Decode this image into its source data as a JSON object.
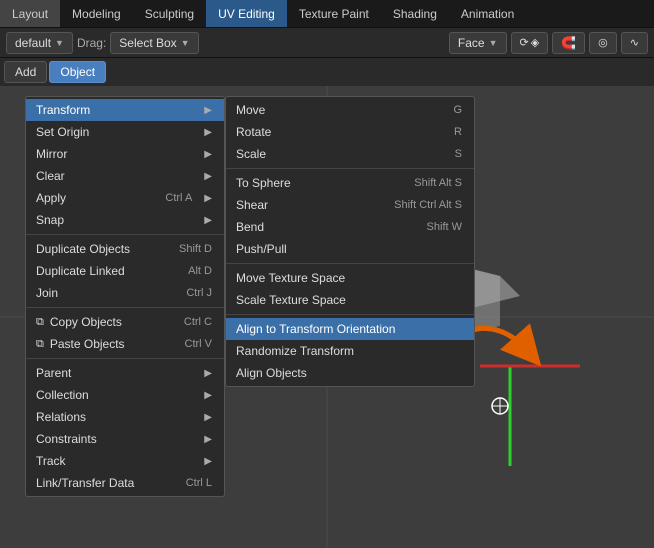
{
  "menubar": {
    "items": [
      {
        "label": "Layout",
        "active": true
      },
      {
        "label": "Modeling",
        "active": false
      },
      {
        "label": "Sculpting",
        "active": false
      },
      {
        "label": "UV Editing",
        "active": false
      },
      {
        "label": "Texture Paint",
        "active": false
      },
      {
        "label": "Shading",
        "active": false
      },
      {
        "label": "Animation",
        "active": false
      }
    ]
  },
  "toolbar": {
    "drag_label": "Drag:",
    "select_mode": "Select Box",
    "mode_dropdown": "Face",
    "default_label": "default"
  },
  "header": {
    "add_label": "Add",
    "object_label": "Object"
  },
  "context_menu": {
    "items": [
      {
        "label": "Transform",
        "submenu": true,
        "highlighted": true
      },
      {
        "label": "Set Origin",
        "submenu": true
      },
      {
        "label": "Mirror",
        "submenu": true
      },
      {
        "label": "Clear",
        "submenu": true
      },
      {
        "label": "Apply",
        "shortcut": "Ctrl A",
        "submenu": true
      },
      {
        "label": "Snap",
        "submenu": true
      },
      {
        "label": "Duplicate Objects",
        "shortcut": "Shift D",
        "separator": true
      },
      {
        "label": "Duplicate Linked",
        "shortcut": "Alt D"
      },
      {
        "label": "Join",
        "shortcut": "Ctrl J"
      },
      {
        "label": "Copy Objects",
        "shortcut": "Ctrl C",
        "separator": true,
        "icon": "copy"
      },
      {
        "label": "Paste Objects",
        "shortcut": "Ctrl V",
        "icon": "paste"
      },
      {
        "label": "Parent",
        "submenu": true,
        "separator": true
      },
      {
        "label": "Collection",
        "submenu": true
      },
      {
        "label": "Relations",
        "submenu": true
      },
      {
        "label": "Constraints",
        "submenu": true
      },
      {
        "label": "Track",
        "submenu": true
      },
      {
        "label": "Link/Transfer Data",
        "shortcut": "Ctrl L"
      }
    ]
  },
  "transform_submenu": {
    "items": [
      {
        "label": "Move",
        "shortcut": "G"
      },
      {
        "label": "Rotate",
        "shortcut": "R"
      },
      {
        "label": "Scale",
        "shortcut": "S"
      },
      {
        "label": "To Sphere",
        "shortcut": "Shift Alt S"
      },
      {
        "label": "Shear",
        "shortcut": "Shift Ctrl Alt S"
      },
      {
        "label": "Bend",
        "shortcut": "Shift W"
      },
      {
        "label": "Push/Pull",
        "shortcut": ""
      },
      {
        "label": "Move Texture Space",
        "shortcut": ""
      },
      {
        "label": "Scale Texture Space",
        "shortcut": ""
      },
      {
        "label": "Align to Transform Orientation",
        "shortcut": "",
        "active": true
      },
      {
        "label": "Randomize Transform",
        "shortcut": ""
      },
      {
        "label": "Align Objects",
        "shortcut": ""
      }
    ]
  }
}
